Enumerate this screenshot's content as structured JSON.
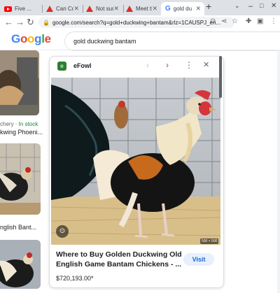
{
  "tabs": [
    {
      "title": "Five ...",
      "icon": "youtube-icon"
    },
    {
      "title": "Can Co",
      "icon": "warning-icon"
    },
    {
      "title": "Not sur",
      "icon": "warning-icon"
    },
    {
      "title": "Meet th",
      "icon": "warning-icon"
    },
    {
      "title": "gold du",
      "icon": "google-icon",
      "active": true
    }
  ],
  "toolbar": {
    "url": "google.com/search?q=gold+duckwing+bantam&rlz=1CAUSPJ_en..."
  },
  "google": {
    "logo": "Google",
    "query": "gold duckwing bantam"
  },
  "left_results": {
    "store_prefix": "chery · ",
    "in_stock": "In stock",
    "title_1": "kwing Phoeni...",
    "title_2": "nglish Bant..."
  },
  "panel": {
    "site_icon": "e",
    "site_name": "eFowl",
    "size_badge": "500 × 500",
    "title": "Where to Buy Golden Duckwing Old English Game Bantam Chickens - ...",
    "price": "$720,193.00*",
    "visit_label": "Visit"
  },
  "colors": {
    "accent": "#1a73e8",
    "in_stock": "#188038",
    "visit_bg": "#e8f0fe"
  }
}
